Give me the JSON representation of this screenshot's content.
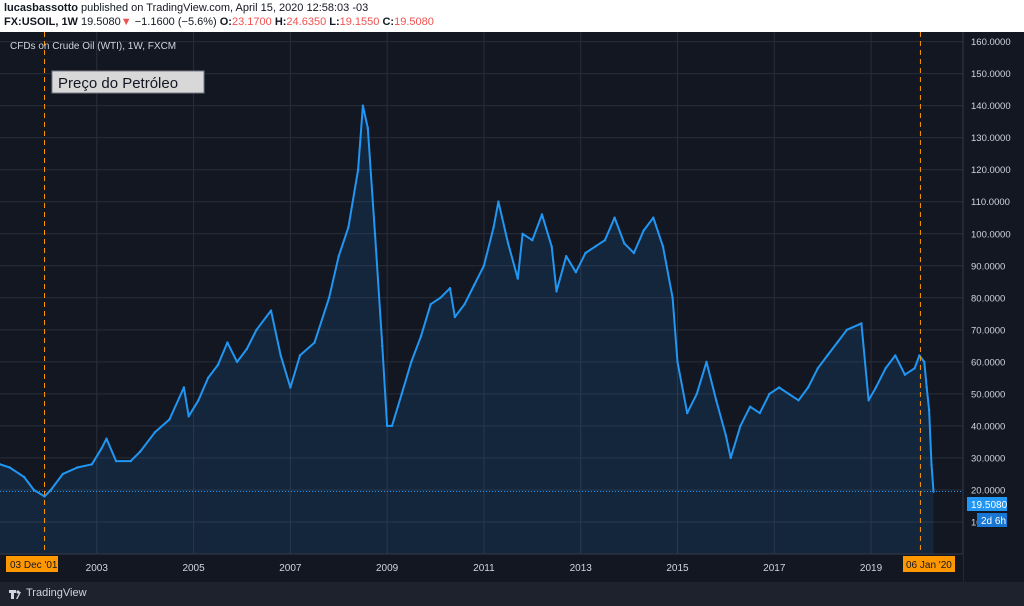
{
  "header": {
    "author": "lucasbassotto",
    "published_text": "published on TradingView.com, April 15, 2020 12:58:03 -03",
    "symbol": "FX:USOIL, 1W",
    "last_price": "19.5080",
    "down_arrow": "▼",
    "change": "−1.1600 (−5.6%)",
    "o_label": "O:",
    "o_value": "23.1700",
    "h_label": "H:",
    "h_value": "24.6350",
    "l_label": "L:",
    "l_value": "19.1550",
    "c_label": "C:",
    "c_value": "19.5080"
  },
  "chart": {
    "series_title": "CFDs on Crude Oil (WTI), 1W, FXCM",
    "annotation": "Preço do Petróleo",
    "price_tag": "19.5080",
    "countdown_tag": "2d 6h",
    "left_marker": "03 Dec '01",
    "right_marker": "06 Jan '20"
  },
  "footer": {
    "brand": "TradingView"
  },
  "colors": {
    "background": "#131722",
    "line": "#2196f3",
    "marker": "#ff9800",
    "grid": "#2a2e39",
    "axis_text": "#d1d4dc"
  },
  "chart_data": {
    "type": "line",
    "title": "CFDs on Crude Oil (WTI), 1W, FXCM",
    "xlabel": "",
    "ylabel": "",
    "y_scale": "linear",
    "ylim": [
      0,
      163
    ],
    "xlim": [
      2001.0,
      2020.9
    ],
    "x_ticks": [
      "2003",
      "2005",
      "2007",
      "2009",
      "2011",
      "2013",
      "2015",
      "2017",
      "2019"
    ],
    "y_ticks": [
      "10.0000",
      "20.0000",
      "30.0000",
      "40.0000",
      "50.0000",
      "60.0000",
      "70.0000",
      "80.0000",
      "90.0000",
      "100.0000",
      "110.0000",
      "120.0000",
      "130.0000",
      "140.0000",
      "150.0000",
      "160.0000"
    ],
    "grid": true,
    "series": [
      {
        "x": [
          2001.0,
          2001.2,
          2001.5,
          2001.7,
          2001.92,
          2002.05,
          2002.3,
          2002.6,
          2002.9,
          2003.1,
          2003.2,
          2003.4,
          2003.7,
          2003.9,
          2004.2,
          2004.5,
          2004.8,
          2004.9,
          2005.1,
          2005.3,
          2005.5,
          2005.7,
          2005.9,
          2006.1,
          2006.3,
          2006.6,
          2006.8,
          2007.0,
          2007.2,
          2007.5,
          2007.8,
          2008.0,
          2008.2,
          2008.4,
          2008.5,
          2008.6,
          2008.75,
          2008.9,
          2009.0,
          2009.1,
          2009.3,
          2009.5,
          2009.7,
          2009.9,
          2010.1,
          2010.3,
          2010.4,
          2010.6,
          2010.8,
          2011.0,
          2011.2,
          2011.3,
          2011.5,
          2011.7,
          2011.8,
          2012.0,
          2012.2,
          2012.4,
          2012.5,
          2012.7,
          2012.9,
          2013.1,
          2013.3,
          2013.5,
          2013.7,
          2013.9,
          2014.1,
          2014.3,
          2014.5,
          2014.7,
          2014.9,
          2015.0,
          2015.2,
          2015.4,
          2015.6,
          2015.8,
          2016.0,
          2016.1,
          2016.3,
          2016.5,
          2016.7,
          2016.9,
          2017.1,
          2017.3,
          2017.5,
          2017.7,
          2017.9,
          2018.1,
          2018.3,
          2018.5,
          2018.8,
          2018.95,
          2019.1,
          2019.3,
          2019.5,
          2019.7,
          2019.9,
          2020.0,
          2020.1,
          2020.15,
          2020.2,
          2020.25,
          2020.29
        ],
        "y": [
          28,
          27,
          24,
          20,
          18,
          20,
          25,
          27,
          28,
          33,
          36,
          29,
          29,
          32,
          38,
          42,
          52,
          43,
          48,
          55,
          59,
          66,
          60,
          64,
          70,
          76,
          62,
          52,
          62,
          66,
          80,
          93,
          102,
          120,
          140,
          133,
          100,
          65,
          40,
          40,
          50,
          60,
          68,
          78,
          80,
          83,
          74,
          78,
          84,
          90,
          102,
          110,
          97,
          86,
          100,
          98,
          106,
          96,
          82,
          93,
          88,
          94,
          96,
          98,
          105,
          97,
          94,
          101,
          105,
          96,
          80,
          60,
          44,
          50,
          60,
          48,
          37,
          30,
          40,
          46,
          44,
          50,
          52,
          50,
          48,
          52,
          58,
          62,
          66,
          70,
          72,
          48,
          52,
          58,
          62,
          56,
          58,
          62,
          60,
          52,
          45,
          28,
          19.5
        ]
      }
    ]
  }
}
